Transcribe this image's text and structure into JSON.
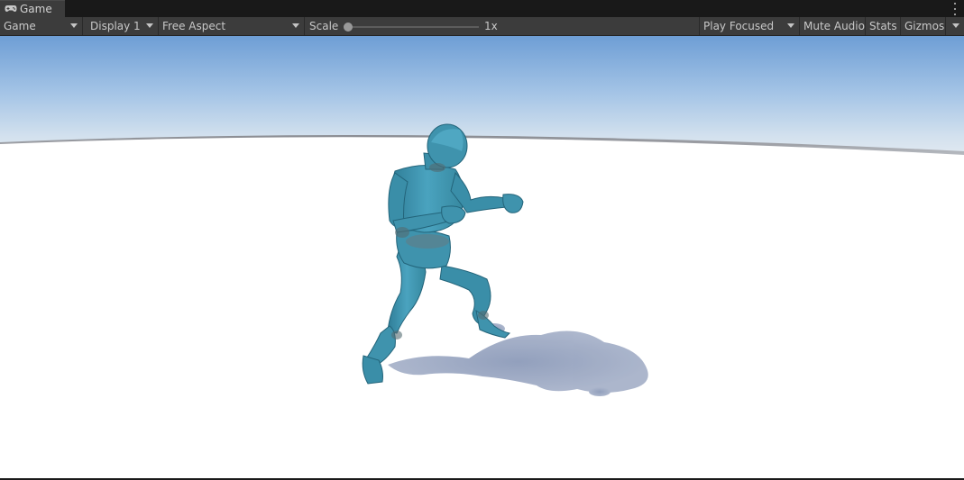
{
  "tab": {
    "title": "Game",
    "icon": "gamepad-icon"
  },
  "toolbar": {
    "view_mode": "Game",
    "display": "Display 1",
    "aspect": "Free Aspect",
    "scale_label": "Scale",
    "scale_value": "1x",
    "play_mode": "Play Focused",
    "mute_audio": "Mute Audio",
    "stats": "Stats",
    "gizmos": "Gizmos"
  },
  "scene": {
    "character_color": "#3f93ad",
    "sky_top": "#6f9fd6",
    "ground_color": "#ffffff",
    "shadow_color": "#8e9bb8"
  }
}
